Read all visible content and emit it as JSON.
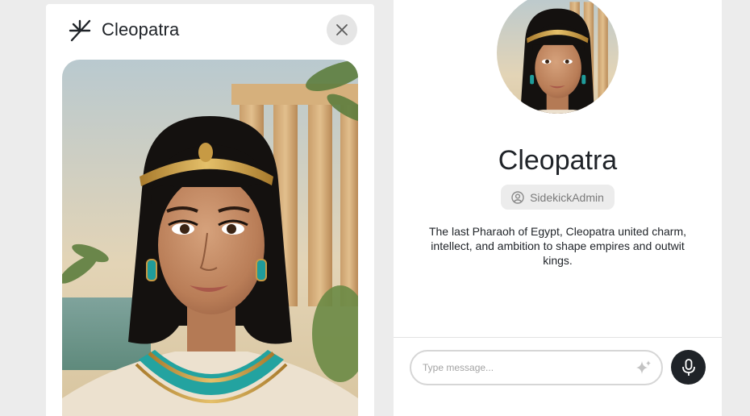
{
  "chat_header": {
    "title": "Cleopatra",
    "logo_icon": "sidekick-asterisk-logo",
    "close_icon": "close-icon"
  },
  "portrait": {
    "subject": "Cleopatra portrait"
  },
  "profile": {
    "name": "Cleopatra",
    "creator": "SidekickAdmin",
    "creator_icon": "user-circle-icon",
    "description": "The last Pharaoh of Egypt, Cleopatra united charm, intellect, and ambition to shape empires and outwit kings."
  },
  "composer": {
    "placeholder": "Type message...",
    "value": "",
    "enhance_icon": "sparkle-icon",
    "mic_icon": "microphone-icon"
  },
  "colors": {
    "page_background": "#ececec",
    "card_background": "#ffffff",
    "text_primary": "#1f2328",
    "badge_background": "#ececec",
    "mic_button": "#1f2328"
  }
}
